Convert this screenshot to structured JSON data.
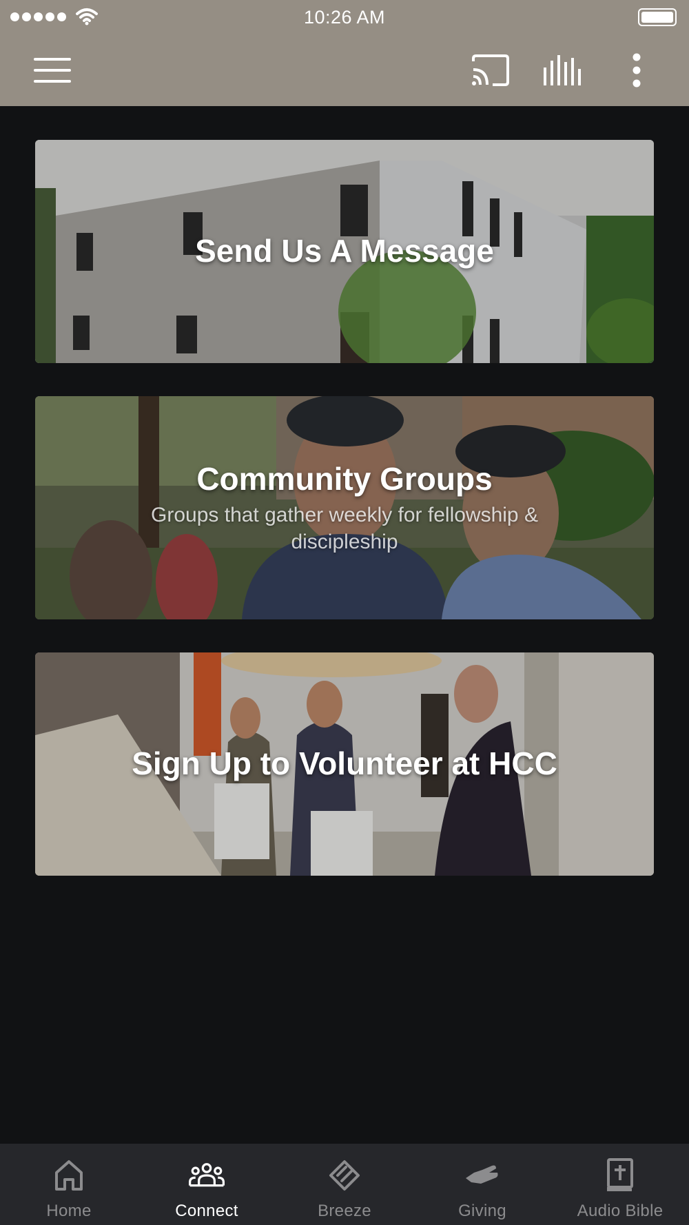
{
  "status_bar": {
    "time": "10:26 AM",
    "signal_icon": "signal-dots-icon",
    "wifi_icon": "wifi-icon",
    "battery_icon": "battery-icon"
  },
  "app_bar": {
    "background": "#958e84",
    "menu_icon": "hamburger-menu-icon",
    "cast_icon": "cast-icon",
    "audio_icon": "audio-bars-icon",
    "more_icon": "more-vertical-icon"
  },
  "cards": [
    {
      "title": "Send Us A Message",
      "subtitle": ""
    },
    {
      "title": "Community Groups",
      "subtitle": "Groups that gather weekly for fellowship & discipleship"
    },
    {
      "title": "Sign Up to Volunteer at HCC",
      "subtitle": ""
    }
  ],
  "bottom_nav": {
    "active_color": "#ffffff",
    "inactive_color": "#8c8c8e",
    "items": [
      {
        "label": "Home",
        "icon": "home-icon",
        "active": false
      },
      {
        "label": "Connect",
        "icon": "people-group-icon",
        "active": true
      },
      {
        "label": "Breeze",
        "icon": "breeze-icon",
        "active": false
      },
      {
        "label": "Giving",
        "icon": "giving-hand-icon",
        "active": false
      },
      {
        "label": "Audio Bible",
        "icon": "bible-icon",
        "active": false
      }
    ]
  }
}
